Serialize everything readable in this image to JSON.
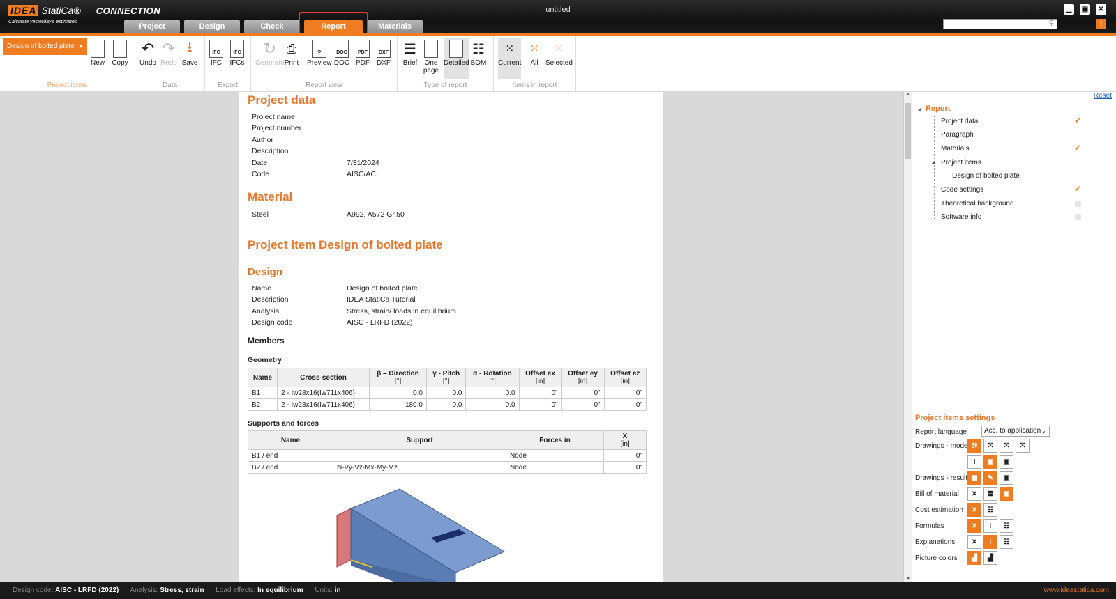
{
  "app": {
    "brand": "IDEA",
    "brand2": "StatiCa®",
    "product": "CONNECTION",
    "tagline": "Calculate yesterday's estimates",
    "window_title": "untitled"
  },
  "tabs": [
    "Project",
    "Design",
    "Check",
    "Report",
    "Materials"
  ],
  "active_tab": "Report",
  "ribbon": {
    "project_item_dropdown": "Design of bolted plate",
    "groups": {
      "project_items": "Project items",
      "data": "Data",
      "export": "Export",
      "report_view": "Report view",
      "type_of_report": "Type of report",
      "items_in_report": "Items in report"
    },
    "buttons": {
      "new": "New",
      "copy": "Copy",
      "undo": "Undo",
      "redo": "Redo",
      "save": "Save",
      "ifc": "IFC",
      "ifcs": "IFCs",
      "generate": "Generate",
      "print": "Print",
      "preview": "Preview",
      "doc": "DOC",
      "pdf": "PDF",
      "dxf": "DXF",
      "brief": "Brief",
      "one_page_1": "One",
      "one_page_2": "page",
      "detailed": "Detailed",
      "bom": "BOM",
      "current": "Current",
      "all": "All",
      "selected": "Selected"
    }
  },
  "report": {
    "project_data_title": "Project data",
    "project_data": [
      {
        "k": "Project name",
        "v": ""
      },
      {
        "k": "Project number",
        "v": ""
      },
      {
        "k": "Author",
        "v": ""
      },
      {
        "k": "Description",
        "v": ""
      },
      {
        "k": "Date",
        "v": "7/31/2024"
      },
      {
        "k": "Code",
        "v": "AISC/ACI"
      }
    ],
    "material_title": "Material",
    "material": [
      {
        "k": "Steel",
        "v": "A992, A572 Gr.50"
      }
    ],
    "project_item_title": "Project item Design of bolted plate",
    "design_title": "Design",
    "design": [
      {
        "k": "Name",
        "v": "Design of bolted plate"
      },
      {
        "k": "Description",
        "v": "IDEA StatiCa Tutorial"
      },
      {
        "k": "Analysis",
        "v": "Stress, strain/ loads in equilibrium"
      },
      {
        "k": "Design code",
        "v": "AISC - LRFD (2022)"
      }
    ],
    "members_title": "Members",
    "geometry_title": "Geometry",
    "geometry_headers": [
      "Name",
      "Cross-section",
      "β – Direction",
      "[°]",
      "γ - Pitch",
      "[°]",
      "α - Rotation",
      "[°]",
      "Offset ex",
      "[in]",
      "Offset ey",
      "[in]",
      "Offset ez",
      "[in]"
    ],
    "geometry_rows": [
      [
        "B1",
        "2 - Iw28x16(Iw711x406)",
        "0.0",
        "0.0",
        "0.0",
        "0\"",
        "0\"",
        "0\""
      ],
      [
        "B2",
        "2 - Iw28x16(Iw711x406)",
        "180.0",
        "0.0",
        "0.0",
        "0\"",
        "0\"",
        "0\""
      ]
    ],
    "supports_title": "Supports and forces",
    "supports_headers": [
      "Name",
      "Support",
      "Forces in",
      "X",
      "[in]"
    ],
    "supports_rows": [
      [
        "B1 / end",
        "",
        "Node",
        "0\""
      ],
      [
        "B2 / end",
        "N-Vy-Vz-Mx-My-Mz",
        "Node",
        "0\""
      ]
    ]
  },
  "panel": {
    "reset": "Reset",
    "tree_root": "Report",
    "tree": [
      {
        "label": "Project data",
        "state": "checked"
      },
      {
        "label": "Paragraph",
        "state": "none"
      },
      {
        "label": "Materials",
        "state": "checked"
      },
      {
        "label": "Project items",
        "state": "none"
      },
      {
        "label": "Design of bolted plate",
        "state": "none"
      },
      {
        "label": "Code settings",
        "state": "checked"
      },
      {
        "label": "Theoretical background",
        "state": "unchecked"
      },
      {
        "label": "Software info",
        "state": "unchecked"
      }
    ],
    "settings_title": "Project items settings",
    "report_language_label": "Report language",
    "report_language_value": "Acc. to application",
    "rows": [
      "Drawings - model",
      "Drawings - results",
      "Bill of material",
      "Cost estimation",
      "Formulas",
      "Explanations",
      "Picture colors"
    ]
  },
  "status": {
    "design_code_label": "Design code:",
    "design_code": "AISC - LRFD (2022)",
    "analysis_label": "Analysis:",
    "analysis": "Stress, strain",
    "load_label": "Load effects:",
    "load": "In equilibrium",
    "units_label": "Units:",
    "units": "in",
    "url": "www.ideastatica.com"
  },
  "colors": {
    "accent": "#f07c22",
    "highlight": "#e53935"
  }
}
